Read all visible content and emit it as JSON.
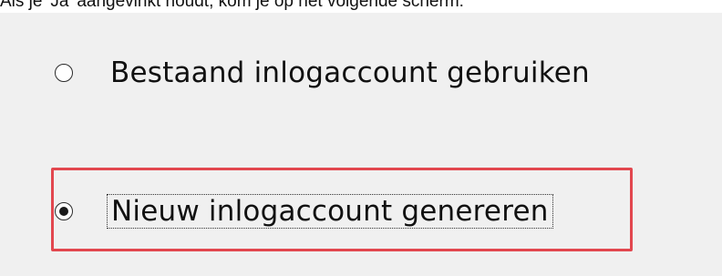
{
  "caption": "Als je 'Ja' aangevinkt houdt, kom je op het volgende scherm:",
  "options": [
    {
      "label": "Bestaand inlogaccount gebruiken",
      "selected": false
    },
    {
      "label": "Nieuw inlogaccount genereren",
      "selected": true
    }
  ],
  "colors": {
    "panel_background": "#f0f0f0",
    "highlight_border": "#e2474f"
  }
}
